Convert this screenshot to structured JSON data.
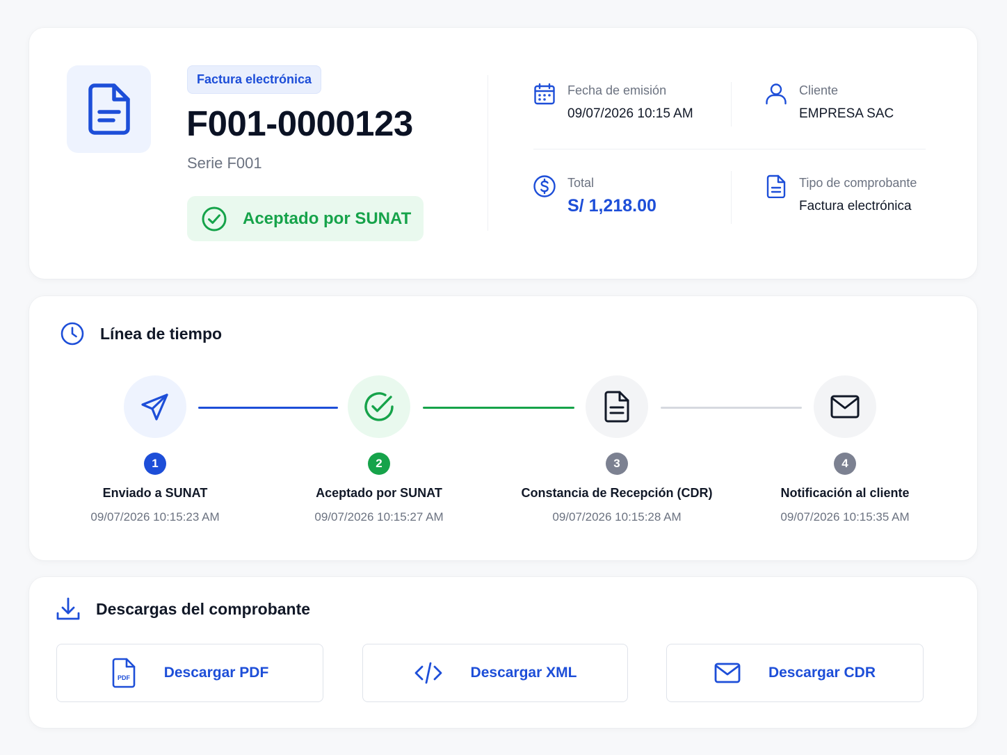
{
  "header": {
    "type_badge": "Factura electrónica",
    "doc_number": "F001-0000123",
    "series": "Serie F001",
    "status": "Aceptado por SUNAT",
    "meta": {
      "issue_date": {
        "label": "Fecha de emisión",
        "value": "09/07/2026 10:15 AM",
        "icon": "calendar-icon"
      },
      "client": {
        "label": "Cliente",
        "value": "EMPRESA SAC",
        "icon": "user-icon"
      },
      "total": {
        "label": "Total",
        "value": "S/ 1,218.00",
        "icon": "dollar-circle-icon"
      },
      "doc_type": {
        "label": "Tipo de comprobante",
        "value": "Factura electrónica",
        "icon": "document-icon"
      }
    }
  },
  "timeline": {
    "title": "Línea de tiempo",
    "steps": [
      {
        "number": "1",
        "name": "Enviado a SUNAT",
        "time": "09/07/2026 10:15:23 AM",
        "icon": "send-icon"
      },
      {
        "number": "2",
        "name": "Aceptado por SUNAT",
        "time": "09/07/2026 10:15:27 AM",
        "icon": "check-circle-icon"
      },
      {
        "number": "3",
        "name": "Constancia de Recepción (CDR)",
        "time": "09/07/2026 10:15:28 AM",
        "icon": "document-icon"
      },
      {
        "number": "4",
        "name": "Notificación al cliente",
        "time": "09/07/2026 10:15:35 AM",
        "icon": "mail-icon"
      }
    ]
  },
  "downloads": {
    "title": "Descargas del comprobante",
    "pdf": {
      "label": "Descargar PDF",
      "icon_text": "PDF"
    },
    "xml": {
      "label": "Descargar XML"
    },
    "cdr": {
      "label": "Descargar CDR"
    }
  },
  "colors": {
    "primary": "#1d4ed8",
    "success": "#16a34a",
    "muted": "#6b7280",
    "pending": "#7c8191"
  }
}
